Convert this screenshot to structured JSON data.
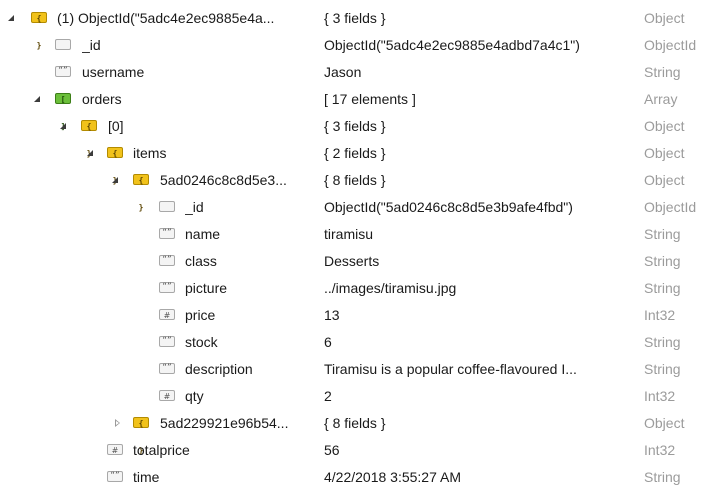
{
  "rows": [
    {
      "key": "(1) ObjectId(\"5adc4e2ec9885e4a...",
      "value": "{ 3 fields }",
      "type": "Object"
    },
    {
      "key": "_id",
      "value": "ObjectId(\"5adc4e2ec9885e4adbd7a4c1\")",
      "type": "ObjectId"
    },
    {
      "key": "username",
      "value": "Jason",
      "type": "String"
    },
    {
      "key": "orders",
      "value": "[ 17 elements ]",
      "type": "Array"
    },
    {
      "key": "[0]",
      "value": "{ 3 fields }",
      "type": "Object"
    },
    {
      "key": "items",
      "value": "{ 2 fields }",
      "type": "Object"
    },
    {
      "key": "5ad0246c8c8d5e3...",
      "value": "{ 8 fields }",
      "type": "Object"
    },
    {
      "key": "_id",
      "value": "ObjectId(\"5ad0246c8c8d5e3b9afe4fbd\")",
      "type": "ObjectId"
    },
    {
      "key": "name",
      "value": "tiramisu",
      "type": "String"
    },
    {
      "key": "class",
      "value": "Desserts",
      "type": "String"
    },
    {
      "key": "picture",
      "value": "../images/tiramisu.jpg",
      "type": "String"
    },
    {
      "key": "price",
      "value": "13",
      "type": "Int32"
    },
    {
      "key": "stock",
      "value": "6",
      "type": "String"
    },
    {
      "key": "description",
      "value": "Tiramisu is a popular coffee-flavoured I...",
      "type": "String"
    },
    {
      "key": "qty",
      "value": "2",
      "type": "Int32"
    },
    {
      "key": "5ad229921e96b54...",
      "value": "{ 8 fields }",
      "type": "Object"
    },
    {
      "key": "totalprice",
      "value": "56",
      "type": "Int32"
    },
    {
      "key": "time",
      "value": "4/22/2018 3:55:27 AM",
      "type": "String"
    }
  ],
  "icons": {
    "object": "object-icon",
    "array": "array-icon",
    "objectid": "objectid-icon",
    "string": "string-icon",
    "int32": "int32-icon",
    "expanded": "expanded-arrow-icon",
    "collapsed": "collapsed-arrow-icon"
  },
  "colors": {
    "object_icon": "#f1c21b",
    "array_icon": "#6bbf3a",
    "type_text": "#9b9b9b"
  }
}
